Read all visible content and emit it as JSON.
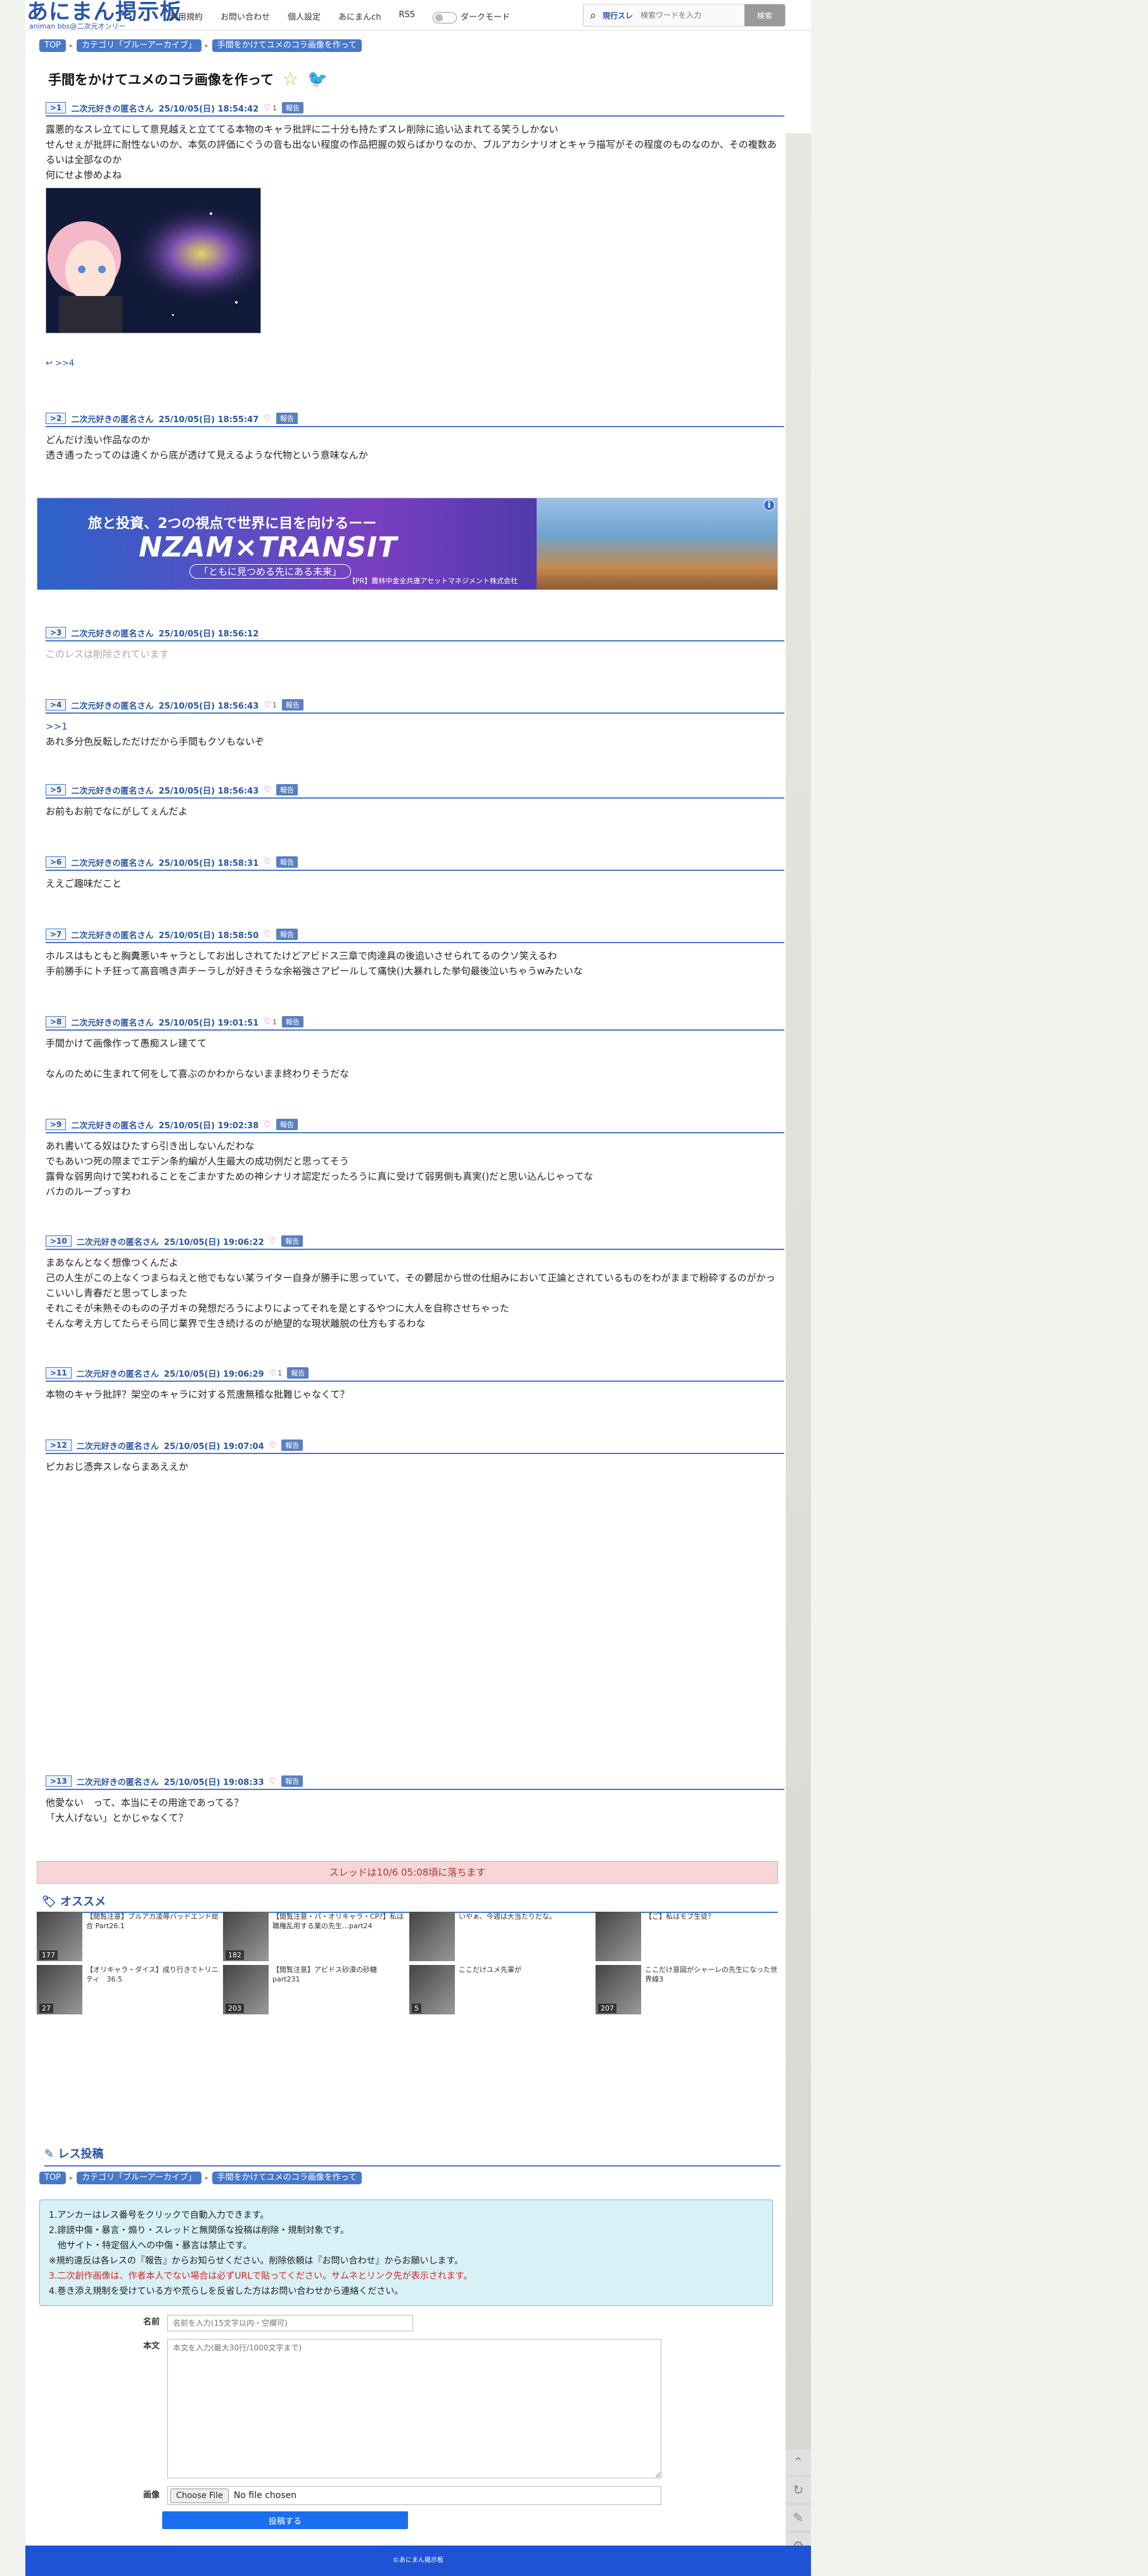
{
  "header": {
    "logo": "あにまん掲示板",
    "logo_sub": "animan bbs@二次元オンリー",
    "nav": [
      "利用規約",
      "お問い合わせ",
      "個人設定",
      "あにまんch",
      "RSS",
      "ダークモード"
    ],
    "search_label": "現行スレ",
    "search_placeholder": "検索ワードを入力",
    "search_button": "検索"
  },
  "breadcrumb": [
    "TOP",
    "カテゴリ「ブルーアーカイブ」",
    "手間をかけてユメのコラ画像を作って"
  ],
  "thread_title": "手間をかけてユメのコラ画像を作って",
  "posts": [
    {
      "no": ">1",
      "name": "二次元好きの匿名さん",
      "date": "25/10/05(日) 18:54:42",
      "likes": "1",
      "report": "報告",
      "body": "露悪的なスレ立てにして意見越えと立ててる本物のキャラ批評に二十分も持たずスレ削除に追い込まれてる笑うしかない\nせんせぇが批評に耐性ないのか、本気の評価にぐうの音も出ない程度の作品把握の奴らばかりなのか、ブルアカシナリオとキャラ描写がその程度のものなのか、その複数あるいは全部なのか\n何にせよ惨めよね",
      "reply_link": ">>4"
    },
    {
      "no": ">2",
      "name": "二次元好きの匿名さん",
      "date": "25/10/05(日) 18:55:47",
      "likes": "",
      "report": "報告",
      "body": "どんだけ浅い作品なのか\n透き通ったってのは遠くから底が透けて見えるような代物という意味なんか"
    },
    {
      "no": ">3",
      "name": "二次元好きの匿名さん",
      "date": "25/10/05(日) 18:56:12",
      "likes": "",
      "report": "",
      "body": "このレスは削除されています"
    },
    {
      "no": ">4",
      "name": "二次元好きの匿名さん",
      "date": "25/10/05(日) 18:56:43",
      "likes": "1",
      "report": "報告",
      "anchor": ">>1",
      "body": "あれ多分色反転しただけだから手間もクソもないぞ"
    },
    {
      "no": ">5",
      "name": "二次元好きの匿名さん",
      "date": "25/10/05(日) 18:56:43",
      "likes": "",
      "report": "報告",
      "body": "お前もお前でなにがしてぇんだよ"
    },
    {
      "no": ">6",
      "name": "二次元好きの匿名さん",
      "date": "25/10/05(日) 18:58:31",
      "likes": "",
      "report": "報告",
      "body": "ええご趣味だこと"
    },
    {
      "no": ">7",
      "name": "二次元好きの匿名さん",
      "date": "25/10/05(日) 18:58:50",
      "likes": "",
      "report": "報告",
      "body": "ホルスはもともと胸糞悪いキャラとしてお出しされてたけどアビドス三章で肉達具の後追いさせられてるのクソ笑えるわ\n手前勝手にトチ狂って高音鳴き声チーラしが好きそうな余裕強さアピールして痛快()大暴れした挙句最後泣いちゃうwみたいな"
    },
    {
      "no": ">8",
      "name": "二次元好きの匿名さん",
      "date": "25/10/05(日) 19:01:51",
      "likes": "1",
      "report": "報告",
      "body": "手間かけて画像作って愚痴スレ建てて\n\nなんのために生まれて何をして喜ぶのかわからないまま終わりそうだな"
    },
    {
      "no": ">9",
      "name": "二次元好きの匿名さん",
      "date": "25/10/05(日) 19:02:38",
      "likes": "",
      "report": "報告",
      "body": "あれ書いてる奴はひたすら引き出しないんだわな\nでもあいつ死の際までエデン条約編が人生最大の成功例だと思ってそう\n露骨な弱男向けで笑われることをごまかすための神シナリオ認定だったろうに真に受けて弱男側も真実()だと思い込んじゃってな\nバカのループっすわ"
    },
    {
      "no": ">10",
      "name": "二次元好きの匿名さん",
      "date": "25/10/05(日) 19:06:22",
      "likes": "",
      "report": "報告",
      "body": "まあなんとなく想像つくんだよ\n己の人生がこの上なくつまらねえと他でもない某ライター自身が勝手に思っていて、その鬱屈から世の仕組みにおいて正論とされているものをわがままで粉砕するのがかっこいいし青春だと思ってしまった\nそれこそが未熟そのものの子ガキの発想だろうによりによってそれを是とするやつに大人を自称させちゃった\nそんな考え方してたらそら同じ業界で生き続けるのが絶望的な現状離脱の仕方もするわな"
    },
    {
      "no": ">11",
      "name": "二次元好きの匿名さん",
      "date": "25/10/05(日) 19:06:29",
      "likes": "1",
      "report": "報告",
      "body": "本物のキャラ批評？架空のキャラに対する荒唐無稽な批難じゃなくて？"
    },
    {
      "no": ">12",
      "name": "二次元好きの匿名さん",
      "date": "25/10/05(日) 19:07:04",
      "likes": "",
      "report": "報告",
      "body": "ピカおじ憑奔スレならまあええか"
    },
    {
      "no": ">13",
      "name": "二次元好きの匿名さん",
      "date": "25/10/05(日) 19:08:33",
      "likes": "",
      "report": "報告",
      "body": "他愛ない　って、本当にその用途であってる？\n「大人げない」とかじゃなくて？"
    }
  ],
  "ad": {
    "headline": "旅と投資、2つの視点で世界に目を向けるーー",
    "brand": "NZAM×TRANSIT",
    "tagline": "「ともに見つめる先にある未来」",
    "pr": "【PR】農林中金全共連アセットマネジメント株式会社"
  },
  "expire_notice": "スレッドは10/6 05:08頃に落ちます",
  "recommend": {
    "heading": "オススメ",
    "items": [
      {
        "title": "【閲覧注意】ブルアカ凌辱バッドエンド総合 Part26.1",
        "count": "177"
      },
      {
        "title": "【閲覧注意・パ・オリキャラ・CP?】私は職権乱用する業の先生…part24",
        "count": "182"
      },
      {
        "title": "いやぁ、今週は大当たりだな。",
        "count": ""
      },
      {
        "title": "【ご】私はモブ生徒？",
        "count": ""
      },
      {
        "title": "【オリキャラ・ダイス】成り行きでトリニティ　36.5",
        "count": "27"
      },
      {
        "title": "【閲覧注意】アビドス砂漠の砂糖 part231",
        "count": "203"
      },
      {
        "title": "ここだけユメ先輩が",
        "count": "5"
      },
      {
        "title": "ここだけ意図がシャーレの先生になった世界線3",
        "count": "207"
      }
    ]
  },
  "form": {
    "heading": "レス投稿",
    "rules": [
      "1.アンカーはレス番号をクリックで自動入力できます。",
      "2.誹謗中傷・暴言・煽り・スレッドと無関係な投稿は削除・規制対象です。",
      "　他サイト・特定個人への中傷・暴言は禁止です。",
      "※規約違反は各レスの『報告』からお知らせください。削除依頼は『お問い合わせ』からお願いします。",
      "3.二次創作画像は、作者本人でない場合は必ずURLで貼ってください。サムネとリンク先が表示されます。",
      "4.巻き添え規制を受けている方や荒らしを反省した方はお問い合わせから連絡ください。"
    ],
    "name_label": "名前",
    "name_placeholder": "名前を入力(15文字以内・空欄可)",
    "body_label": "本文",
    "body_placeholder": "本文を入力(最大30行/1000文字まで)",
    "image_label": "画像",
    "file_button": "Choose File",
    "file_status": "No file chosen",
    "submit": "投稿する"
  },
  "footer": "©あにまん掲示板",
  "colors": {
    "accent": "#2855a6",
    "button": "#1a6ff0",
    "footer": "#1e53d6",
    "notice": "#f6d6d6"
  }
}
